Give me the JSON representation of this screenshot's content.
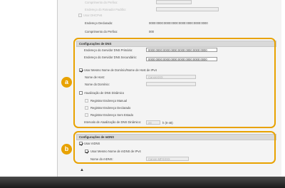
{
  "top_rows": {
    "prefix_length_label": "Comprimento do Prefixo:",
    "router_address_label": "Endereço do Roteador Padrão:",
    "use_dhcpv6_label": "Usar DHCPv6",
    "declared_address_label": "Endereço Declarado:",
    "declared_address_value": "0000:0000:0000:0000:0000:0000:0000:0000",
    "prefix_length2_label": "Comprimento do Prefixo:",
    "prefix_length2_value": "000"
  },
  "dns": {
    "title": "Configurações de DNS",
    "primary_label": "Endereço do Servidor DNS Primário:",
    "primary_value": "0000:0000:0000:0000:0000:0000:0000:0000",
    "secondary_label": "Endereço do Servidor DNS Secundário:",
    "secondary_value": "0000:0000:0000:0000:0000:0000:0000:0000",
    "same_name_label": "Usar Mesmo Nome de Domínio/Nome de Host de IPv4",
    "host_name_label": "Nome de Host:",
    "host_name_value": "CanonXXX",
    "domain_name_label": "Nome do Domínio:",
    "dynamic_update_label": "Atualização de DNS Dinâmico",
    "manual_label": "Registrar Endereço Manual",
    "declared_label": "Registrar Endereço Declarado",
    "stateless_label": "Registrar Endereço Sem Estado",
    "interval_label": "Intervalo de Atualização de DNS Dinâmico:",
    "interval_value": "24",
    "interval_unit": "h (0-48)"
  },
  "mdns": {
    "title": "Configurações de mDNS",
    "use_label": "Usar mDNS",
    "same_name_label": "Usar Mesmo Nome de mDNS de IPv4",
    "name_label": "Nome do mDNS:",
    "name_value": "Canon MFXXXX"
  },
  "callouts": {
    "a": "a",
    "b": "b"
  },
  "icons": {
    "up_arrow": "▲"
  },
  "colors": {
    "highlight": "#e8a200"
  }
}
